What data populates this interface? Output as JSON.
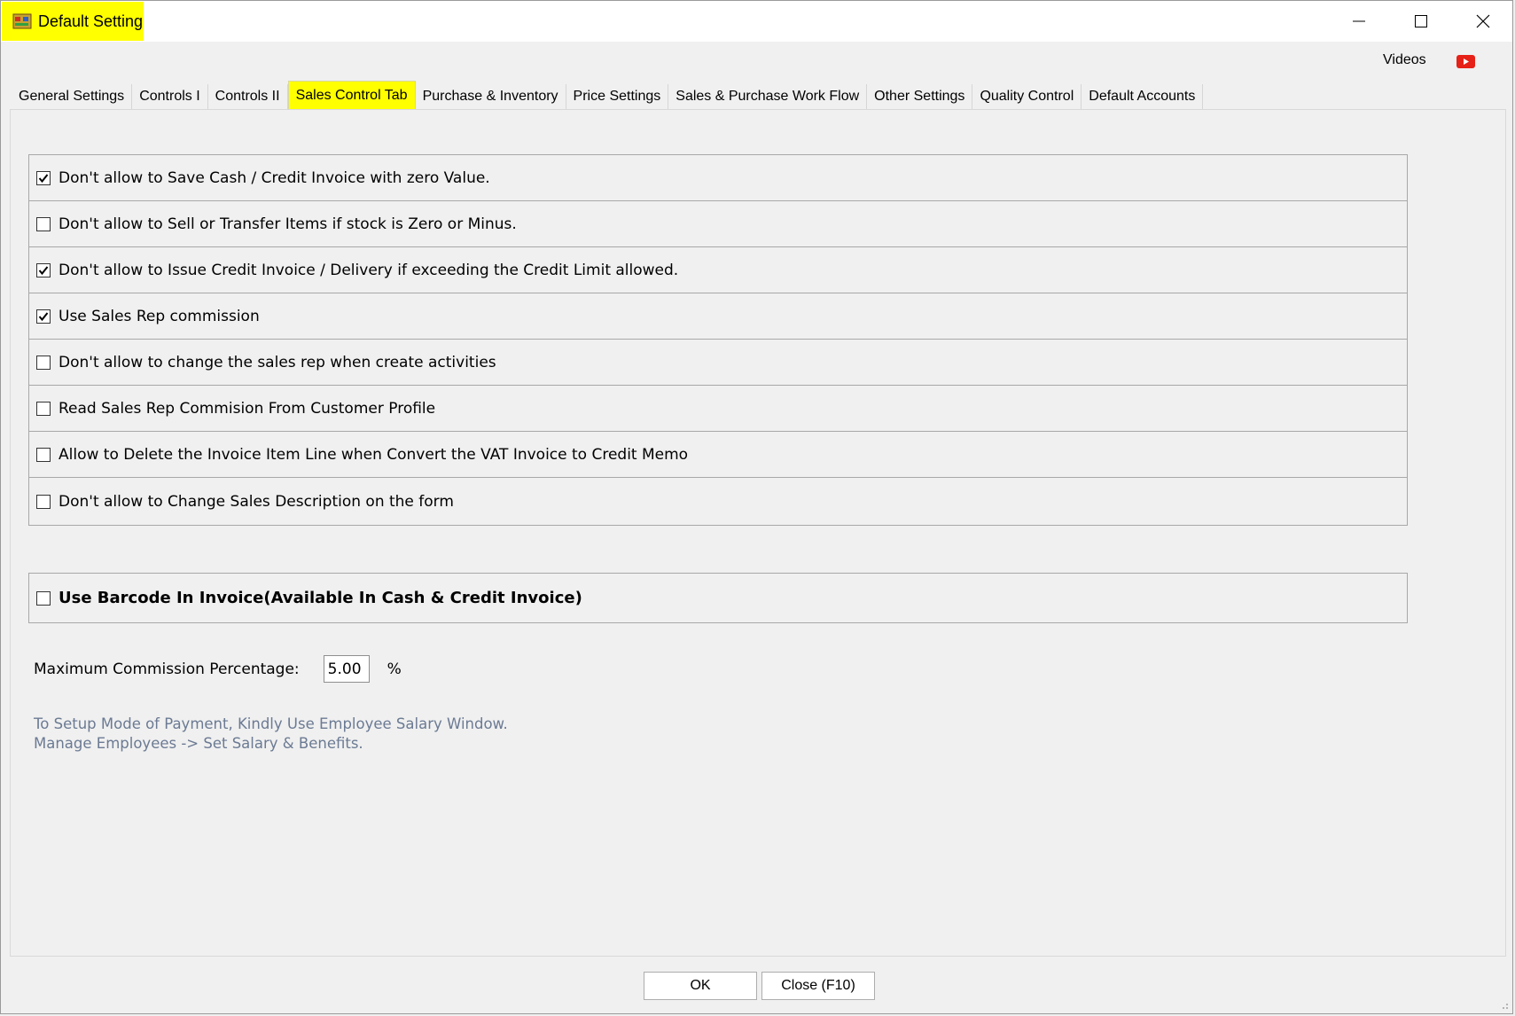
{
  "window": {
    "title": "Default Setting",
    "minimize_symbol": "—",
    "maximize_symbol": "☐",
    "close_symbol": "✕"
  },
  "header": {
    "videos_label": "Videos",
    "videos_icon": "youtube-icon"
  },
  "tabs": [
    {
      "label": "General Settings",
      "active": false
    },
    {
      "label": "Controls I",
      "active": false
    },
    {
      "label": "Controls II",
      "active": false
    },
    {
      "label": "Sales Control Tab",
      "active": true
    },
    {
      "label": "Purchase & Inventory",
      "active": false
    },
    {
      "label": "Price Settings",
      "active": false
    },
    {
      "label": "Sales & Purchase Work Flow",
      "active": false
    },
    {
      "label": "Other Settings",
      "active": false
    },
    {
      "label": "Quality Control",
      "active": false
    },
    {
      "label": "Default Accounts",
      "active": false
    }
  ],
  "options": [
    {
      "label": "Don't allow to Save Cash / Credit Invoice with zero Value.",
      "checked": true
    },
    {
      "label": "Don't allow to Sell or Transfer Items if stock is Zero or Minus.",
      "checked": false
    },
    {
      "label": "Don't allow to Issue Credit Invoice / Delivery if exceeding the Credit Limit allowed.",
      "checked": true
    },
    {
      "label": "Use Sales Rep commission",
      "checked": true
    },
    {
      "label": "Don't allow to change the sales rep when create activities",
      "checked": false
    },
    {
      "label": "Read Sales Rep Commision From Customer Profile",
      "checked": false
    },
    {
      "label": "Allow to Delete the Invoice Item Line when Convert the VAT Invoice to Credit Memo",
      "checked": false
    },
    {
      "label": "Don't allow to Change Sales Description on the form",
      "checked": false
    }
  ],
  "barcode": {
    "label": "Use Barcode In Invoice(Available In Cash & Credit Invoice)",
    "checked": false
  },
  "commission": {
    "label": "Maximum Commission Percentage:",
    "value": "5.00",
    "unit": "%"
  },
  "info": {
    "line1": "To Setup Mode of Payment, Kindly Use Employee Salary Window.",
    "line2": "Manage Employees -> Set Salary & Benefits."
  },
  "footer": {
    "ok_label": "OK",
    "close_label": "Close (F10)"
  },
  "colors": {
    "highlight": "#ffff00",
    "info_text": "#6b7a93",
    "youtube_red": "#e62117"
  }
}
